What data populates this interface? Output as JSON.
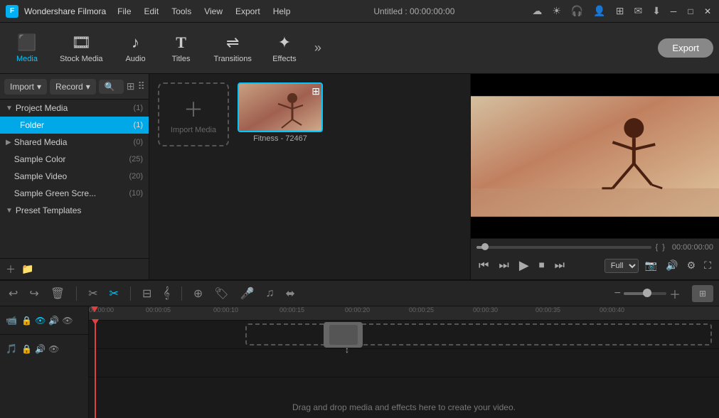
{
  "app": {
    "name": "Wondershare Filmora",
    "title": "Untitled : 00:00:00:00"
  },
  "menu": {
    "items": [
      "File",
      "Edit",
      "Tools",
      "View",
      "Export",
      "Help"
    ]
  },
  "toolbar": {
    "tabs": [
      {
        "id": "media",
        "label": "Media",
        "icon": "🎬",
        "active": true
      },
      {
        "id": "stock",
        "label": "Stock Media",
        "icon": "📦",
        "active": false
      },
      {
        "id": "audio",
        "label": "Audio",
        "icon": "🎵",
        "active": false
      },
      {
        "id": "titles",
        "label": "Titles",
        "icon": "T",
        "active": false
      },
      {
        "id": "transitions",
        "label": "Transitions",
        "icon": "⟷",
        "active": false
      },
      {
        "id": "effects",
        "label": "Effects",
        "icon": "✨",
        "active": false
      }
    ],
    "export_label": "Export"
  },
  "panel": {
    "import_label": "Import",
    "record_label": "Record",
    "search_placeholder": "Search media",
    "tree": [
      {
        "id": "project-media",
        "label": "Project Media",
        "count": "(1)",
        "expanded": true,
        "children": [
          {
            "id": "folder",
            "label": "Folder",
            "count": "(1)",
            "active": true
          }
        ]
      },
      {
        "id": "shared-media",
        "label": "Shared Media",
        "count": "(0)",
        "expanded": false
      },
      {
        "id": "sample-color",
        "label": "Sample Color",
        "count": "(25)",
        "expanded": false
      },
      {
        "id": "sample-video",
        "label": "Sample Video",
        "count": "(20)",
        "expanded": false
      },
      {
        "id": "sample-green",
        "label": "Sample Green Scre...",
        "count": "(10)",
        "expanded": false
      },
      {
        "id": "preset-templates",
        "label": "Preset Templates",
        "count": "",
        "expanded": true
      }
    ]
  },
  "media": {
    "import_drop_label": "Import Media",
    "items": [
      {
        "id": "fitness",
        "label": "Fitness - 72467",
        "has_overlay": true
      }
    ]
  },
  "preview": {
    "time": "00:00:00:00",
    "progress": 0,
    "quality": "Full",
    "transport": {
      "rewind": "⏮",
      "step_back": "⏭",
      "play": "▶",
      "stop": "⏹",
      "step_fwd": "⏭"
    }
  },
  "timeline": {
    "toolbar_buttons": [
      "↩",
      "↪",
      "🗑",
      "✂",
      "◯",
      "⊟",
      "𝌇",
      "𝌊"
    ],
    "right_buttons": [
      "🔒",
      "🎤",
      "⊞",
      "☌"
    ],
    "zoom": {
      "minus": "−",
      "plus": "+"
    },
    "ruler_marks": [
      "00:00:00",
      "00:00:05",
      "00:00:10",
      "00:00:15",
      "00:00:20",
      "00:00:25",
      "00:00:30",
      "00:00:35",
      "00:00:40"
    ],
    "drop_text": "Drag and drop media and effects here to create your video.",
    "tracks": [
      {
        "id": "track1",
        "icons": [
          "📹",
          "🔒",
          "🔊",
          "👁"
        ]
      },
      {
        "id": "track2",
        "icons": [
          "🎵",
          "🔒",
          "🔊",
          "👁"
        ]
      }
    ]
  },
  "colors": {
    "accent": "#00c8ff",
    "bg_dark": "#1a1a1a",
    "bg_mid": "#252525",
    "bg_light": "#2b2b2b",
    "border": "#111111",
    "text_primary": "#cccccc",
    "text_muted": "#888888",
    "red_line": "#e04040",
    "export_bg": "#888888"
  }
}
